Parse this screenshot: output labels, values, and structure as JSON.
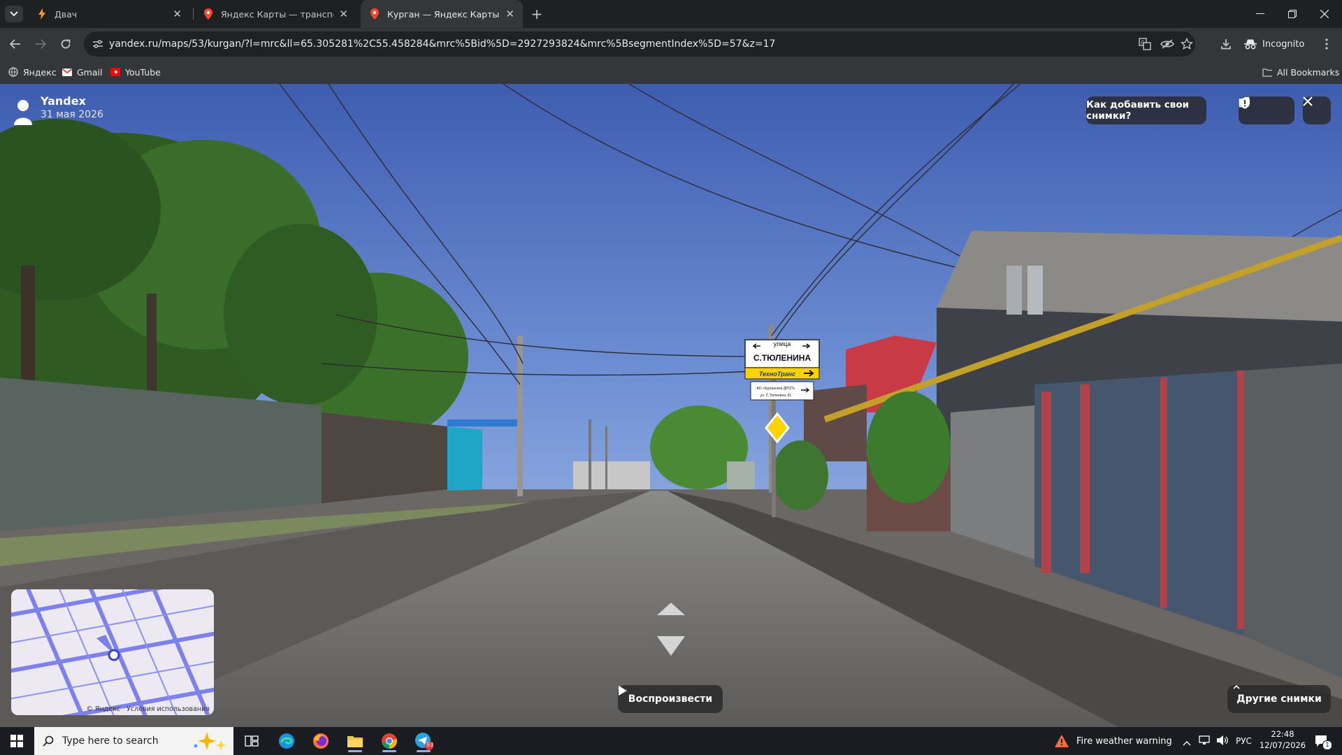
{
  "browser": {
    "tabs": [
      {
        "title": "Двач",
        "active": false
      },
      {
        "title": "Яндекс Карты — транспорт, н",
        "active": false
      },
      {
        "title": "Курган — Яндекс Карты",
        "active": true
      }
    ],
    "url": "yandex.ru/maps/53/kurgan/?l=mrc&ll=65.305281%2C55.458284&mrc%5Bid%5D=2927293824&mrc%5BsegmentIndex%5D=57&z=17",
    "incognito_label": "Incognito",
    "bookmarks": [
      {
        "label": "Яндекс",
        "icon": "yandex-icon"
      },
      {
        "label": "Gmail",
        "icon": "gmail-icon"
      },
      {
        "label": "YouTube",
        "icon": "youtube-icon"
      }
    ],
    "all_bookmarks_label": "All Bookmarks"
  },
  "panorama": {
    "author_name": "Yandex",
    "author_date": "31 мая 2026",
    "add_photos_label": "Как добавить свои снимки?",
    "play_label": "Воспроизвести",
    "other_photos_label": "Другие снимки",
    "signs": {
      "main_line1": "улица",
      "main_line2": "С.ТЮЛЕНИНА",
      "yellow": "ТехноТранс",
      "small_line1": "АО «Курганское ДРСП»",
      "small_line2": "ул. С.Тюленина, 81"
    },
    "minimap": {
      "copyright": "© Яндекс",
      "terms": "Условия использования"
    }
  },
  "taskbar": {
    "search_placeholder": "Type here to search",
    "weather_text": "Fire weather warning",
    "language": "РУС",
    "time": "22:48",
    "date": "12/07/2026",
    "telegram_badge": "93",
    "notification_count": "1"
  }
}
